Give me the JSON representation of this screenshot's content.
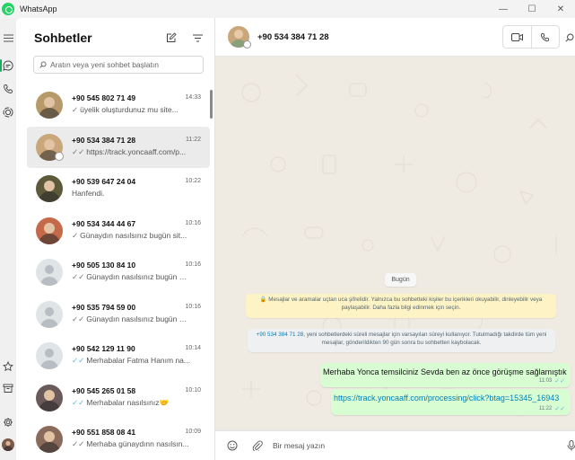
{
  "window": {
    "title": "WhatsApp",
    "controls": [
      "—",
      "☐",
      "✕"
    ]
  },
  "rail": {
    "icons": [
      "menu-icon",
      "chats-icon",
      "calls-icon",
      "status-icon",
      "starred-icon",
      "archive-icon",
      "settings-icon",
      "profile-avatar"
    ]
  },
  "list": {
    "title": "Sohbetler",
    "search_placeholder": "Aratın veya yeni sohbet başlatın",
    "chats": [
      {
        "name": "+90 545 802 71 49",
        "time": "14:33",
        "tick": "✓",
        "preview": "üyelik oluşturdunuz mu site...",
        "avatar": "photo",
        "avatar_color": "#b89a6a",
        "read": false
      },
      {
        "name": "+90 534 384 71 28",
        "time": "11:22",
        "tick": "✓✓",
        "preview": "https://track.yoncaaff.com/p...",
        "avatar": "photo",
        "avatar_color": "#c9a77a",
        "read": false
      },
      {
        "name": "+90 539 647 24 04",
        "time": "10:22",
        "tick": "",
        "preview": "Hanfendi.",
        "avatar": "photo",
        "avatar_color": "#5c5a3a",
        "read": false
      },
      {
        "name": "+90 534 344 44 67",
        "time": "10:16",
        "tick": "✓",
        "preview": "Günaydın nasılsınız bugün sit...",
        "avatar": "photo",
        "avatar_color": "#c46a4a",
        "read": false
      },
      {
        "name": "+90 505 130 84 10",
        "time": "10:16",
        "tick": "✓✓",
        "preview": "Günaydın nasılsınız bugün si...",
        "avatar": "placeholder",
        "avatar_color": "#dfe5e7",
        "read": false
      },
      {
        "name": "+90 535 794 59 00",
        "time": "10:16",
        "tick": "✓✓",
        "preview": "Günaydın nasılsınız bugün si...",
        "avatar": "placeholder",
        "avatar_color": "#dfe5e7",
        "read": false
      },
      {
        "name": "+90 542 129 11 90",
        "time": "10:14",
        "tick": "✓✓",
        "preview": "Merhabalar Fatma Hanım na...",
        "avatar": "placeholder",
        "avatar_color": "#dfe5e7",
        "read": true
      },
      {
        "name": "+90 545 265 01 58",
        "time": "10:10",
        "tick": "✓✓",
        "preview": "Merhabalar nasılsınız🤝",
        "avatar": "photo",
        "avatar_color": "#6b5a5a",
        "read": true
      },
      {
        "name": "+90 551 858 08 41",
        "time": "10:09",
        "tick": "✓✓",
        "preview": "Merhaba günaydınn nasılsın...",
        "avatar": "photo",
        "avatar_color": "#8a6a5a",
        "read": false
      }
    ]
  },
  "conversation": {
    "contact": "+90 534 384 71 28",
    "date_chip": "Bugün",
    "encryption_notice": "🔒 Mesajlar ve aramalar uçtan uca şifrelidir. Yalnızca bu sohbetteki kişiler bu içerikleri okuyabilir, dinleyebilir veya paylaşabilir. Daha fazla bilgi edinmek için seçin.",
    "timer_phone": "+90 534 384 71 28",
    "timer_notice": ", yeni sohbetlerdeki süreli mesajlar için varsayılan süreyi kullanıyor. Tutulmadığı takdirde tüm yeni mesajlar, gönderildikten 90 gün sonra bu sohbetten kaybolacak.",
    "messages": [
      {
        "text": "Merhaba Yonca temsilciniz Sevda ben az önce görüşme sağlamıştık",
        "time": "11:03",
        "tick": "✓✓",
        "is_link": false
      },
      {
        "text": "https://track.yoncaaff.com/processing/click?btag=15345_16943",
        "time": "11:22",
        "tick": "✓✓",
        "is_link": true
      }
    ],
    "compose_placeholder": "Bir mesaj yazın"
  },
  "colors": {
    "accent": "#1daa61",
    "bubble_out": "#d9fdd3",
    "conversation_bg": "#efeae2",
    "link": "#027eb5",
    "read_tick": "#53bdeb"
  }
}
